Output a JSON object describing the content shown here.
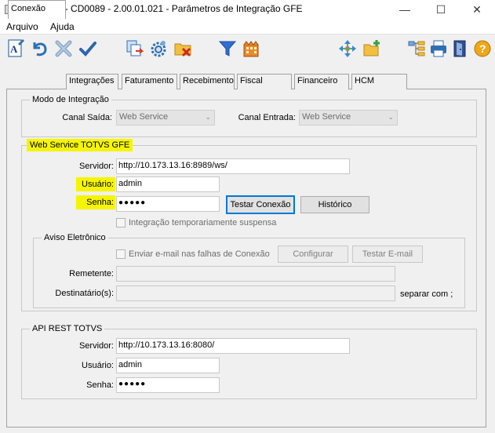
{
  "window": {
    "title": "06.9.5503 - CD0089 - 2.00.01.021 - Parâmetros de Integração GFE"
  },
  "menu": {
    "items": [
      "Arquivo",
      "Ajuda"
    ]
  },
  "toolbar": {
    "buttons": [
      "edit-icon",
      "undo-icon",
      "delete-icon",
      "confirm-icon",
      "copy-icon",
      "settings-icon",
      "folder-delete-icon",
      "filter-icon",
      "building-icon",
      "move-icon",
      "new-folder-icon",
      "tree-icon",
      "print-icon",
      "exit-icon",
      "help-icon"
    ]
  },
  "tabs": [
    "Conexão",
    "Integrações",
    "Faturamento",
    "Recebimento",
    "Fiscal",
    "Financeiro",
    "HCM"
  ],
  "modo": {
    "title": "Modo de Integração",
    "saida_label": "Canal Saída:",
    "saida_value": "Web Service",
    "entrada_label": "Canal Entrada:",
    "entrada_value": "Web Service"
  },
  "webservice": {
    "title": "Web Service TOTVS GFE",
    "servidor_label": "Servidor:",
    "servidor_value": "http://10.173.13.16:8989/ws/",
    "usuario_label": "Usuário:",
    "usuario_value": "admin",
    "senha_label": "Senha:",
    "senha_value": "●●●●●",
    "testar_label": "Testar Conexão",
    "historico_label": "Histórico",
    "suspensa_label": "Integração temporariamente suspensa"
  },
  "aviso": {
    "title": "Aviso Eletrônico",
    "enviar_label": "Enviar e-mail nas falhas de Conexão",
    "configurar_label": "Configurar",
    "testar_email_label": "Testar E-mail",
    "remetente_label": "Remetente:",
    "destinatarios_label": "Destinatário(s):",
    "separar_label": "separar com ;"
  },
  "rest": {
    "title": "API REST TOTVS",
    "servidor_label": "Servidor:",
    "servidor_value": "http://10.173.13.16:8080/",
    "usuario_label": "Usuário:",
    "usuario_value": "admin",
    "senha_label": "Senha:",
    "senha_value": "●●●●●"
  },
  "colors": {
    "highlight": "#f5f500",
    "focus_border": "#0078d7",
    "title_bar": "#ffffff",
    "window_bg": "#f0f0f0"
  }
}
